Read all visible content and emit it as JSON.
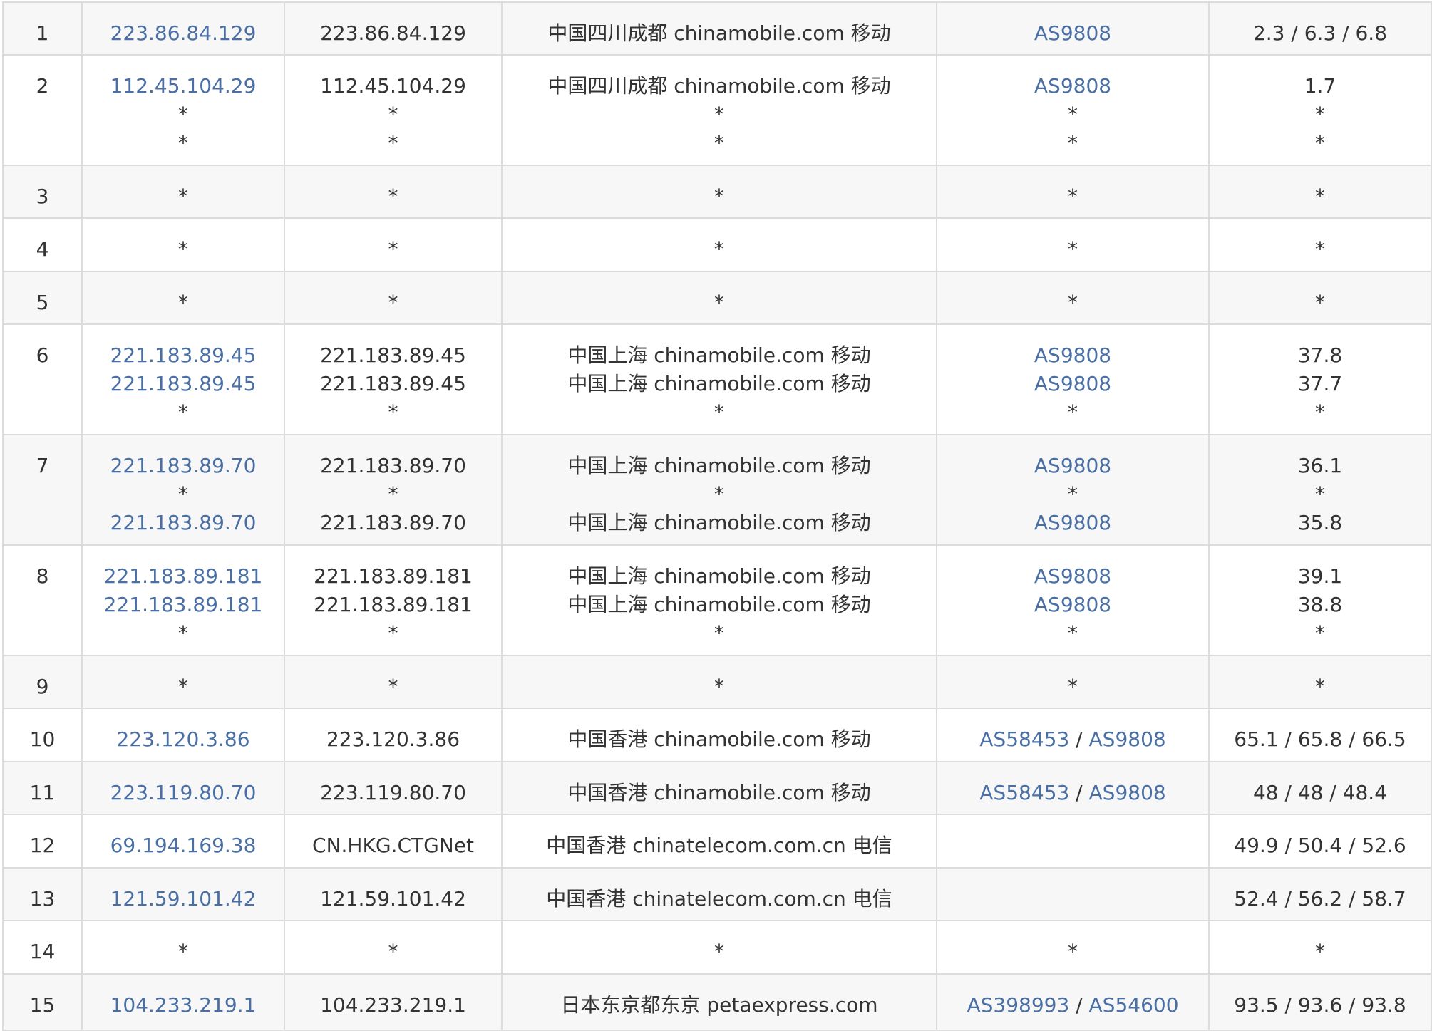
{
  "hops": [
    {
      "hop": "1",
      "row_h": 74,
      "lines": [
        {
          "ip": "223.86.84.129",
          "host": "223.86.84.129",
          "geo": "中国四川成都 chinamobile.com 移动",
          "as": [
            "AS9808"
          ],
          "rtt": "2.3 / 6.3 / 6.8"
        }
      ]
    },
    {
      "hop": "2",
      "row_h": 155,
      "lines": [
        {
          "ip": "112.45.104.29",
          "host": "112.45.104.29",
          "geo": "中国四川成都 chinamobile.com 移动",
          "as": [
            "AS9808"
          ],
          "rtt": "1.7"
        },
        {
          "ip": "*",
          "host": "*",
          "geo": "*",
          "as": [
            "*"
          ],
          "rtt": "*"
        },
        {
          "ip": "*",
          "host": "*",
          "geo": "*",
          "as": [
            "*"
          ],
          "rtt": "*"
        }
      ]
    },
    {
      "hop": "3",
      "row_h": 74,
      "lines": [
        {
          "ip": "*",
          "host": "*",
          "geo": "*",
          "as": [
            "*"
          ],
          "rtt": "*"
        }
      ]
    },
    {
      "hop": "4",
      "row_h": 75,
      "lines": [
        {
          "ip": "*",
          "host": "*",
          "geo": "*",
          "as": [
            "*"
          ],
          "rtt": "*"
        }
      ]
    },
    {
      "hop": "5",
      "row_h": 74,
      "lines": [
        {
          "ip": "*",
          "host": "*",
          "geo": "*",
          "as": [
            "*"
          ],
          "rtt": "*"
        }
      ]
    },
    {
      "hop": "6",
      "row_h": 155,
      "lines": [
        {
          "ip": "221.183.89.45",
          "host": "221.183.89.45",
          "geo": "中国上海 chinamobile.com 移动",
          "as": [
            "AS9808"
          ],
          "rtt": "37.8"
        },
        {
          "ip": "221.183.89.45",
          "host": "221.183.89.45",
          "geo": "中国上海 chinamobile.com 移动",
          "as": [
            "AS9808"
          ],
          "rtt": "37.7"
        },
        {
          "ip": "*",
          "host": "*",
          "geo": "*",
          "as": [
            "*"
          ],
          "rtt": "*"
        }
      ]
    },
    {
      "hop": "7",
      "row_h": 155,
      "lines": [
        {
          "ip": "221.183.89.70",
          "host": "221.183.89.70",
          "geo": "中国上海 chinamobile.com 移动",
          "as": [
            "AS9808"
          ],
          "rtt": "36.1"
        },
        {
          "ip": "*",
          "host": "*",
          "geo": "*",
          "as": [
            "*"
          ],
          "rtt": "*"
        },
        {
          "ip": "221.183.89.70",
          "host": "221.183.89.70",
          "geo": "中国上海 chinamobile.com 移动",
          "as": [
            "AS9808"
          ],
          "rtt": "35.8"
        }
      ]
    },
    {
      "hop": "8",
      "row_h": 155,
      "lines": [
        {
          "ip": "221.183.89.181",
          "host": "221.183.89.181",
          "geo": "中国上海 chinamobile.com 移动",
          "as": [
            "AS9808"
          ],
          "rtt": "39.1"
        },
        {
          "ip": "221.183.89.181",
          "host": "221.183.89.181",
          "geo": "中国上海 chinamobile.com 移动",
          "as": [
            "AS9808"
          ],
          "rtt": "38.8"
        },
        {
          "ip": "*",
          "host": "*",
          "geo": "*",
          "as": [
            "*"
          ],
          "rtt": "*"
        }
      ]
    },
    {
      "hop": "9",
      "row_h": 74,
      "lines": [
        {
          "ip": "*",
          "host": "*",
          "geo": "*",
          "as": [
            "*"
          ],
          "rtt": "*"
        }
      ]
    },
    {
      "hop": "10",
      "row_h": 75,
      "lines": [
        {
          "ip": "223.120.3.86",
          "host": "223.120.3.86",
          "geo": "中国香港 chinamobile.com 移动",
          "as": [
            "AS58453",
            "AS9808"
          ],
          "rtt": "65.1 / 65.8 / 66.5"
        }
      ]
    },
    {
      "hop": "11",
      "row_h": 74,
      "lines": [
        {
          "ip": "223.119.80.70",
          "host": "223.119.80.70",
          "geo": "中国香港 chinamobile.com 移动",
          "as": [
            "AS58453",
            "AS9808"
          ],
          "rtt": "48 / 48 / 48.4"
        }
      ]
    },
    {
      "hop": "12",
      "row_h": 75,
      "lines": [
        {
          "ip": "69.194.169.38",
          "host": "CN.HKG.CTGNet",
          "geo": "中国香港 chinatelecom.com.cn 电信",
          "as": [],
          "rtt": "49.9 / 50.4 / 52.6"
        }
      ]
    },
    {
      "hop": "13",
      "row_h": 74,
      "lines": [
        {
          "ip": "121.59.101.42",
          "host": "121.59.101.42",
          "geo": "中国香港 chinatelecom.com.cn 电信",
          "as": [],
          "rtt": "52.4 / 56.2 / 58.7"
        }
      ]
    },
    {
      "hop": "14",
      "row_h": 75,
      "lines": [
        {
          "ip": "*",
          "host": "*",
          "geo": "*",
          "as": [
            "*"
          ],
          "rtt": "*"
        }
      ]
    },
    {
      "hop": "15",
      "row_h": 79,
      "lines": [
        {
          "ip": "104.233.219.1",
          "host": "104.233.219.1",
          "geo": "日本东京都东京 petaexpress.com",
          "as": [
            "AS398993",
            "AS54600"
          ],
          "rtt": "93.5 / 93.6 / 93.8"
        }
      ]
    }
  ],
  "colors": {
    "link": "#4a6fa5",
    "text": "#333333",
    "border": "#dcdcdc",
    "row_alt": "#f7f7f7"
  }
}
